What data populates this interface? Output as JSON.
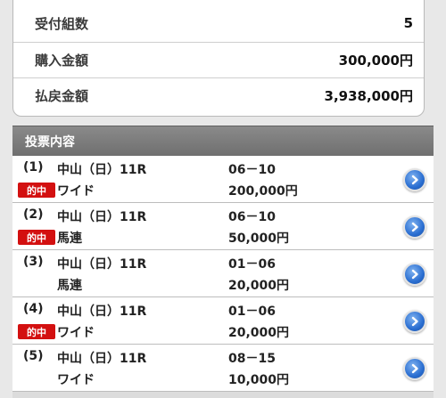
{
  "summary": {
    "rows": [
      {
        "label": "受付組数",
        "value": "5"
      },
      {
        "label": "購入金額",
        "value": "300,000円"
      },
      {
        "label": "払戻金額",
        "value": "3,938,000円"
      }
    ]
  },
  "section": {
    "title": "投票内容"
  },
  "bets": [
    {
      "num": "(1)",
      "race": "中山（日）11R",
      "combo": "06－10",
      "type": "ワイド",
      "amount": "200,000円",
      "hit": true,
      "hit_label": "的中"
    },
    {
      "num": "(2)",
      "race": "中山（日）11R",
      "combo": "06－10",
      "type": "馬連",
      "amount": "50,000円",
      "hit": true,
      "hit_label": "的中"
    },
    {
      "num": "(3)",
      "race": "中山（日）11R",
      "combo": "01－06",
      "type": "馬連",
      "amount": "20,000円",
      "hit": false,
      "hit_label": ""
    },
    {
      "num": "(4)",
      "race": "中山（日）11R",
      "combo": "01－06",
      "type": "ワイド",
      "amount": "20,000円",
      "hit": true,
      "hit_label": "的中"
    },
    {
      "num": "(5)",
      "race": "中山（日）11R",
      "combo": "08－15",
      "type": "ワイド",
      "amount": "10,000円",
      "hit": false,
      "hit_label": ""
    }
  ],
  "icons": {
    "row_action": "chevron-right-circle-icon"
  },
  "colors": {
    "hit_badge": "#d31010",
    "header_bg": "#7a7a7a",
    "action_blue": "#2a6ed1"
  }
}
